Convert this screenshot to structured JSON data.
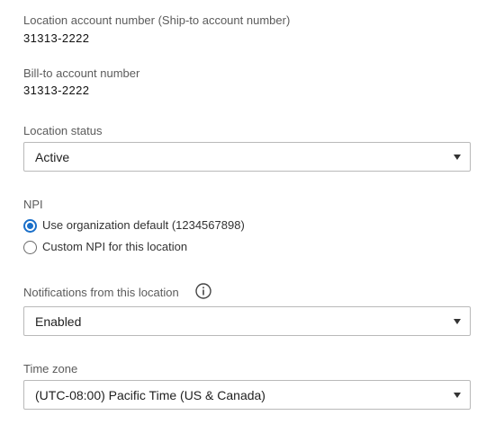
{
  "ship_to": {
    "label": "Location account number (Ship-to account number)",
    "value": "31313-2222"
  },
  "bill_to": {
    "label": "Bill-to account number",
    "value": "31313-2222"
  },
  "location_status": {
    "label": "Location status",
    "selected": "Active"
  },
  "npi": {
    "label": "NPI",
    "options": [
      {
        "label": "Use organization default (1234567898)",
        "checked": true
      },
      {
        "label": "Custom NPI for this location",
        "checked": false
      }
    ]
  },
  "notifications": {
    "label": "Notifications from this location",
    "info_icon": "info-circle-icon",
    "selected": "Enabled"
  },
  "time_zone": {
    "label": "Time zone",
    "selected": "(UTC-08:00) Pacific Time (US & Canada)"
  },
  "colors": {
    "accent": "#1a6fc9",
    "border": "#b9b9b9",
    "label": "#5b5b5b"
  }
}
